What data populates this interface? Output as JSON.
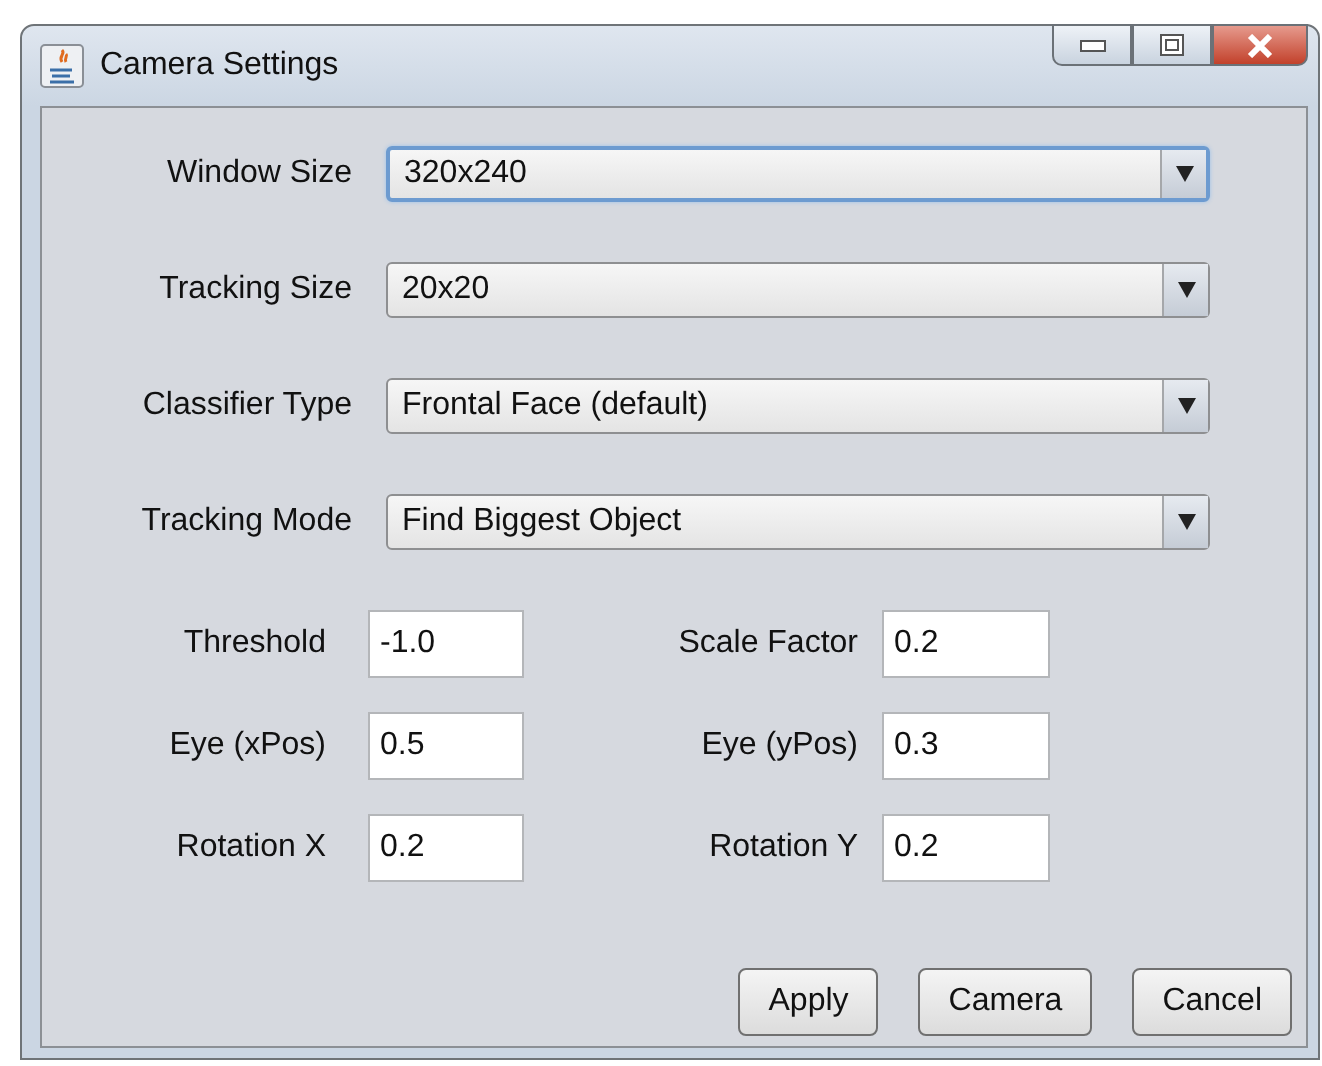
{
  "window": {
    "title": "Camera Settings"
  },
  "dropdowns": [
    {
      "label": "Window Size",
      "value": "320x240",
      "focused": true
    },
    {
      "label": "Tracking Size",
      "value": "20x20",
      "focused": false
    },
    {
      "label": "Classifier Type",
      "value": "Frontal Face (default)",
      "focused": false
    },
    {
      "label": "Tracking Mode",
      "value": "Find Biggest Object",
      "focused": false
    }
  ],
  "fields": [
    {
      "label": "Threshold",
      "value": "-1.0"
    },
    {
      "label": "Scale Factor",
      "value": "0.2"
    },
    {
      "label": "Eye (xPos)",
      "value": "0.5"
    },
    {
      "label": "Eye (yPos)",
      "value": "0.3"
    },
    {
      "label": "Rotation X",
      "value": "0.2"
    },
    {
      "label": "Rotation Y",
      "value": "0.2"
    }
  ],
  "buttons": [
    "Apply",
    "Camera",
    "Cancel"
  ]
}
